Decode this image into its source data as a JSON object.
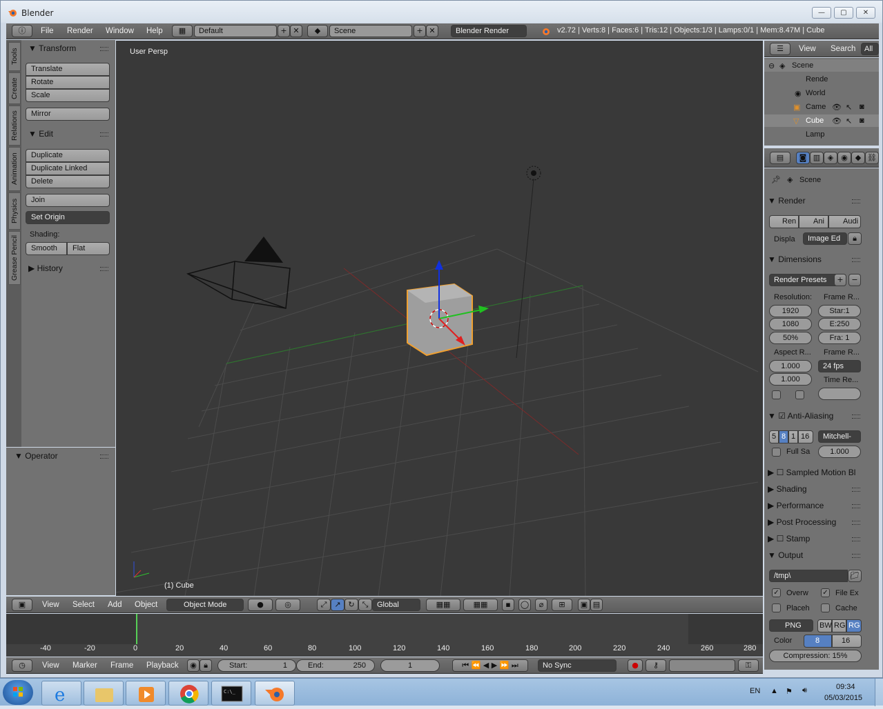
{
  "window": {
    "title": "Blender"
  },
  "info_header": {
    "menus": [
      "File",
      "Render",
      "Window",
      "Help"
    ],
    "layout": "Default",
    "scene": "Scene",
    "engine": "Blender Render",
    "stats": "v2.72 | Verts:8 | Faces:6 | Tris:12 | Objects:1/3 | Lamps:0/1 | Mem:8.47M | Cube"
  },
  "tool_tabs": [
    "Tools",
    "Create",
    "Relations",
    "Animation",
    "Physics",
    "Grease Pencil"
  ],
  "tools": {
    "transform_title": "Transform",
    "translate": "Translate",
    "rotate": "Rotate",
    "scale": "Scale",
    "mirror": "Mirror",
    "edit_title": "Edit",
    "duplicate": "Duplicate",
    "duplicate_linked": "Duplicate Linked",
    "delete": "Delete",
    "join": "Join",
    "set_origin": "Set Origin",
    "shading_label": "Shading:",
    "smooth": "Smooth",
    "flat": "Flat",
    "history": "History",
    "operator": "Operator"
  },
  "viewport": {
    "view_label": "User Persp",
    "object_label": "(1) Cube"
  },
  "view3d_header": {
    "menus": [
      "View",
      "Select",
      "Add",
      "Object"
    ],
    "mode": "Object Mode",
    "orientation": "Global"
  },
  "timeline": {
    "ticks": [
      "-40",
      "-20",
      "0",
      "20",
      "40",
      "60",
      "80",
      "100",
      "120",
      "140",
      "160",
      "180",
      "200",
      "220",
      "240",
      "260",
      "280"
    ],
    "menus": [
      "View",
      "Marker",
      "Frame",
      "Playback"
    ],
    "start_label": "Start:",
    "start": "1",
    "end_label": "End:",
    "end": "250",
    "current": "1",
    "sync": "No Sync"
  },
  "outliner": {
    "menus": [
      "View",
      "Search",
      "All"
    ],
    "items": [
      "Scene",
      "Rende",
      "World",
      "Came",
      "Cube",
      "Lamp"
    ]
  },
  "properties": {
    "context": "Scene",
    "render_title": "Render",
    "render_btns": [
      "Ren",
      "Ani",
      "Audi"
    ],
    "display_label": "Displa",
    "display_value": "Image Ed",
    "dimensions_title": "Dimensions",
    "presets": "Render Presets",
    "resolution_label": "Resolution:",
    "frame_range_label": "Frame R...",
    "res_x": "1920",
    "res_y": "1080",
    "res_pct": "50%",
    "frame_start": "Star:1",
    "frame_end": "E:250",
    "frame_step": "Fra: 1",
    "aspect_label": "Aspect R...",
    "frame_rate_label": "Frame R...",
    "aspect_x": "1.000",
    "aspect_y": "1.000",
    "fps": "24 fps",
    "time_remap_label": "Time Re...",
    "aa_title": "Anti-Aliasing",
    "aa_samples": [
      "5",
      "8",
      "1",
      "16"
    ],
    "aa_filter": "Mitchell-",
    "full_sample": "Full Sa",
    "filter_size": "1.000",
    "sampled_motion": "Sampled Motion Bl",
    "shading": "Shading",
    "performance": "Performance",
    "post_processing": "Post Processing",
    "stamp": "Stamp",
    "output_title": "Output",
    "output_path": "/tmp\\",
    "overwrite": "Overw",
    "file_ext": "File Ex",
    "placeholders": "Placeh",
    "cache": "Cache",
    "format": "PNG",
    "color_modes": [
      "BW",
      "RG",
      "RG"
    ],
    "color_label": "Color",
    "depths": [
      "8",
      "16"
    ],
    "compression": "Compression:",
    "compression_value": "15%"
  },
  "taskbar": {
    "lang": "EN",
    "time": "09:34",
    "date": "05/03/2015"
  }
}
